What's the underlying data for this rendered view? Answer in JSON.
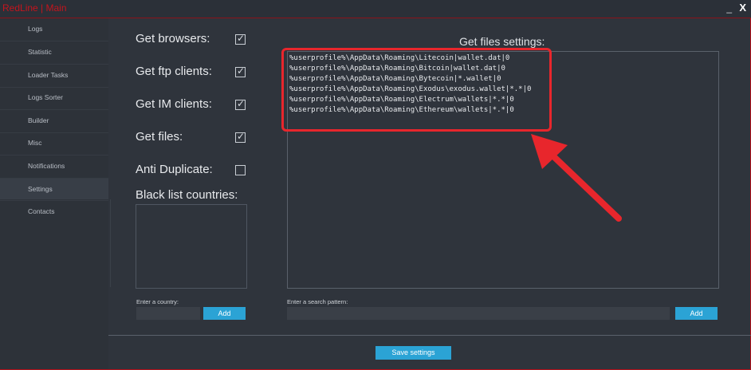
{
  "window": {
    "title": "RedLine | Main",
    "minimize": "_",
    "close": "X"
  },
  "sidebar": {
    "items": [
      {
        "label": "Logs"
      },
      {
        "label": "Statistic"
      },
      {
        "label": "Loader Tasks"
      },
      {
        "label": "Logs Sorter"
      },
      {
        "label": "Builder"
      },
      {
        "label": "Misc"
      },
      {
        "label": "Notifications"
      },
      {
        "label": "Settings",
        "active": true
      },
      {
        "label": "Contacts"
      }
    ]
  },
  "settings": {
    "get_browsers": {
      "label": "Get browsers:",
      "checked": true
    },
    "get_ftp": {
      "label": "Get ftp clients:",
      "checked": true
    },
    "get_im": {
      "label": "Get IM clients:",
      "checked": true
    },
    "get_files": {
      "label": "Get files:",
      "checked": true
    },
    "anti_duplicate": {
      "label": "Anti Duplicate:",
      "checked": false
    },
    "blacklist_title": "Black list countries:",
    "country_label": "Enter a country:",
    "country_add": "Add",
    "files_title": "Get files settings:",
    "files_lines": [
      "%userprofile%\\AppData\\Roaming\\Litecoin|wallet.dat|0",
      "%userprofile%\\AppData\\Roaming\\Bitcoin|wallet.dat|0",
      "%userprofile%\\AppData\\Roaming\\Bytecoin|*.wallet|0",
      "%userprofile%\\AppData\\Roaming\\Exodus\\exodus.wallet|*.*|0",
      "%userprofile%\\AppData\\Roaming\\Electrum\\wallets|*.*|0",
      "%userprofile%\\AppData\\Roaming\\Ethereum\\wallets|*.*|0"
    ],
    "pattern_label": "Enter a search pattern:",
    "pattern_add": "Add",
    "save": "Save settings"
  },
  "colors": {
    "accent": "#2ba3d5",
    "highlight": "#e8262c",
    "title": "#c4141d"
  }
}
